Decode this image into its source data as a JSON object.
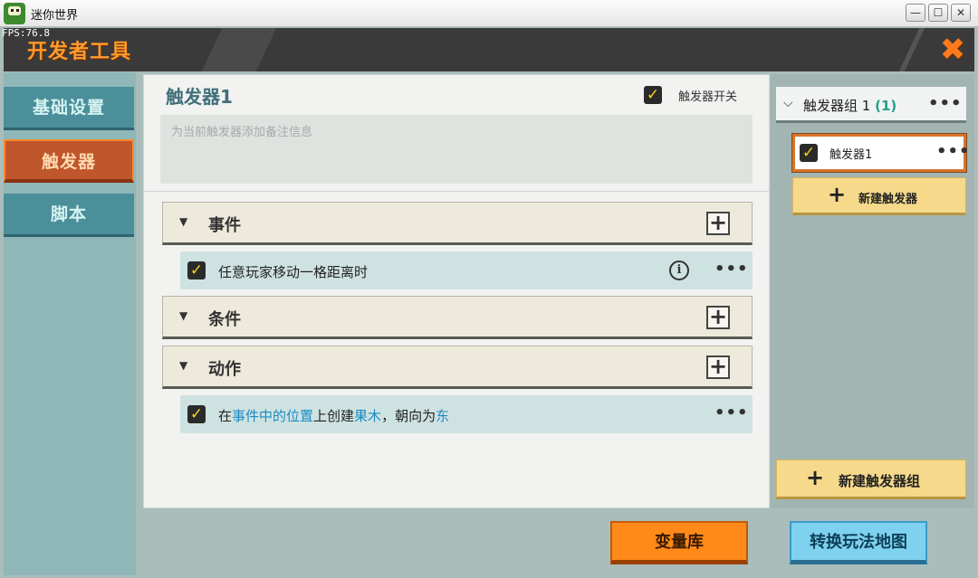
{
  "window": {
    "title": "迷你世界",
    "fps": "FPS:76.8",
    "minimize_glyph": "—",
    "maximize_glyph": "☐",
    "close_glyph": "✕"
  },
  "header": {
    "title": "开发者工具",
    "close_glyph": "✖"
  },
  "left_tabs": [
    {
      "label": "基础设置",
      "active": false
    },
    {
      "label": "触发器",
      "active": true
    },
    {
      "label": "脚本",
      "active": false
    }
  ],
  "main": {
    "trigger_name": "触发器1",
    "switch_label": "触发器开关",
    "switch_checked": true,
    "note_placeholder": "为当前触发器添加备注信息",
    "sections": [
      {
        "title": "事件"
      },
      {
        "title": "条件"
      },
      {
        "title": "动作"
      }
    ],
    "event_item": {
      "text": "任意玩家移动一格距离时",
      "checked": true
    },
    "action_item": {
      "checked": true,
      "parts": [
        "在",
        "事件中的位置",
        "上创建",
        "果木",
        "，朝向为",
        "东"
      ]
    },
    "plus_glyph": "+",
    "dots_glyph": "•••",
    "info_glyph": "i"
  },
  "right": {
    "group_label": "触发器组 1",
    "group_count": "(1)",
    "trigger_item": "触发器1",
    "add_trigger": "新建触发器",
    "add_group": "新建触发器组"
  },
  "buttons": {
    "variable_library": "变量库",
    "switch_map": "转换玩法地图"
  },
  "colors": {
    "accent_orange": "#ff8a1a",
    "teal_tab": "#4a8f9a",
    "active_tab": "#c0562b",
    "highlight_text": "#1a8bc4",
    "checkbox_tick": "#ffd21a",
    "button_blue": "#7fd2ef"
  },
  "icons": {
    "checkbox": "check-icon",
    "close": "close-x-icon",
    "expand": "triangle-down-icon",
    "info": "info-circle-icon"
  }
}
